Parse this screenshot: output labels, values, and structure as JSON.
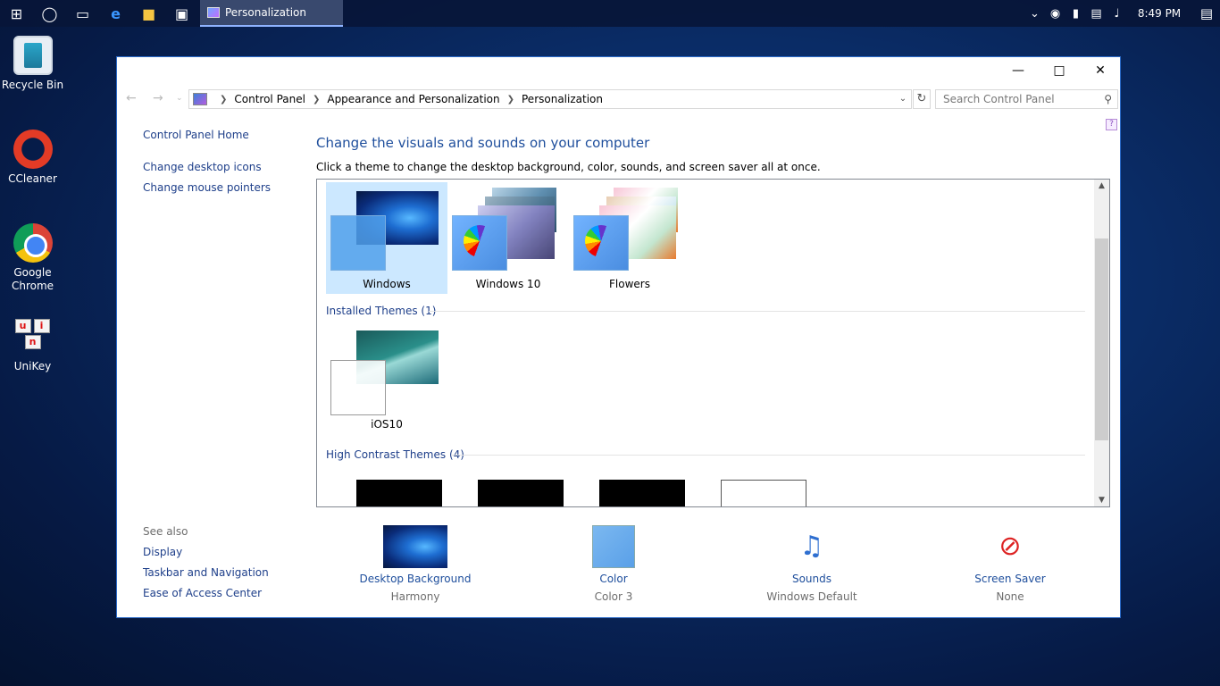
{
  "taskbar": {
    "active_window": "Personalization",
    "clock": "8:49 PM"
  },
  "desktop": {
    "icons": [
      "Recycle Bin",
      "CCleaner",
      "Google Chrome",
      "UniKey"
    ]
  },
  "window": {
    "breadcrumb": [
      "Control Panel",
      "Appearance and Personalization",
      "Personalization"
    ],
    "search_placeholder": "Search Control Panel",
    "left_links": [
      "Control Panel Home",
      "Change desktop icons",
      "Change mouse pointers"
    ],
    "see_also_label": "See also",
    "see_also_links": [
      "Display",
      "Taskbar and Navigation",
      "Ease of Access Center"
    ],
    "title": "Change the visuals and sounds on your computer",
    "description": "Click a theme to change the desktop background, color, sounds, and screen saver all at once.",
    "themes": [
      "Windows",
      "Windows 10",
      "Flowers"
    ],
    "selected_theme": "Windows",
    "installed_heading": "Installed Themes (1)",
    "installed_themes": [
      "iOS10"
    ],
    "high_contrast_heading": "High Contrast Themes (4)",
    "quick_settings": [
      {
        "label": "Desktop Background",
        "value": "Harmony"
      },
      {
        "label": "Color",
        "value": "Color 3"
      },
      {
        "label": "Sounds",
        "value": "Windows Default"
      },
      {
        "label": "Screen Saver",
        "value": "None"
      }
    ]
  },
  "colors": {
    "link": "#1e3f8a",
    "heading": "#1e4e9c",
    "selection": "#cce8ff"
  }
}
